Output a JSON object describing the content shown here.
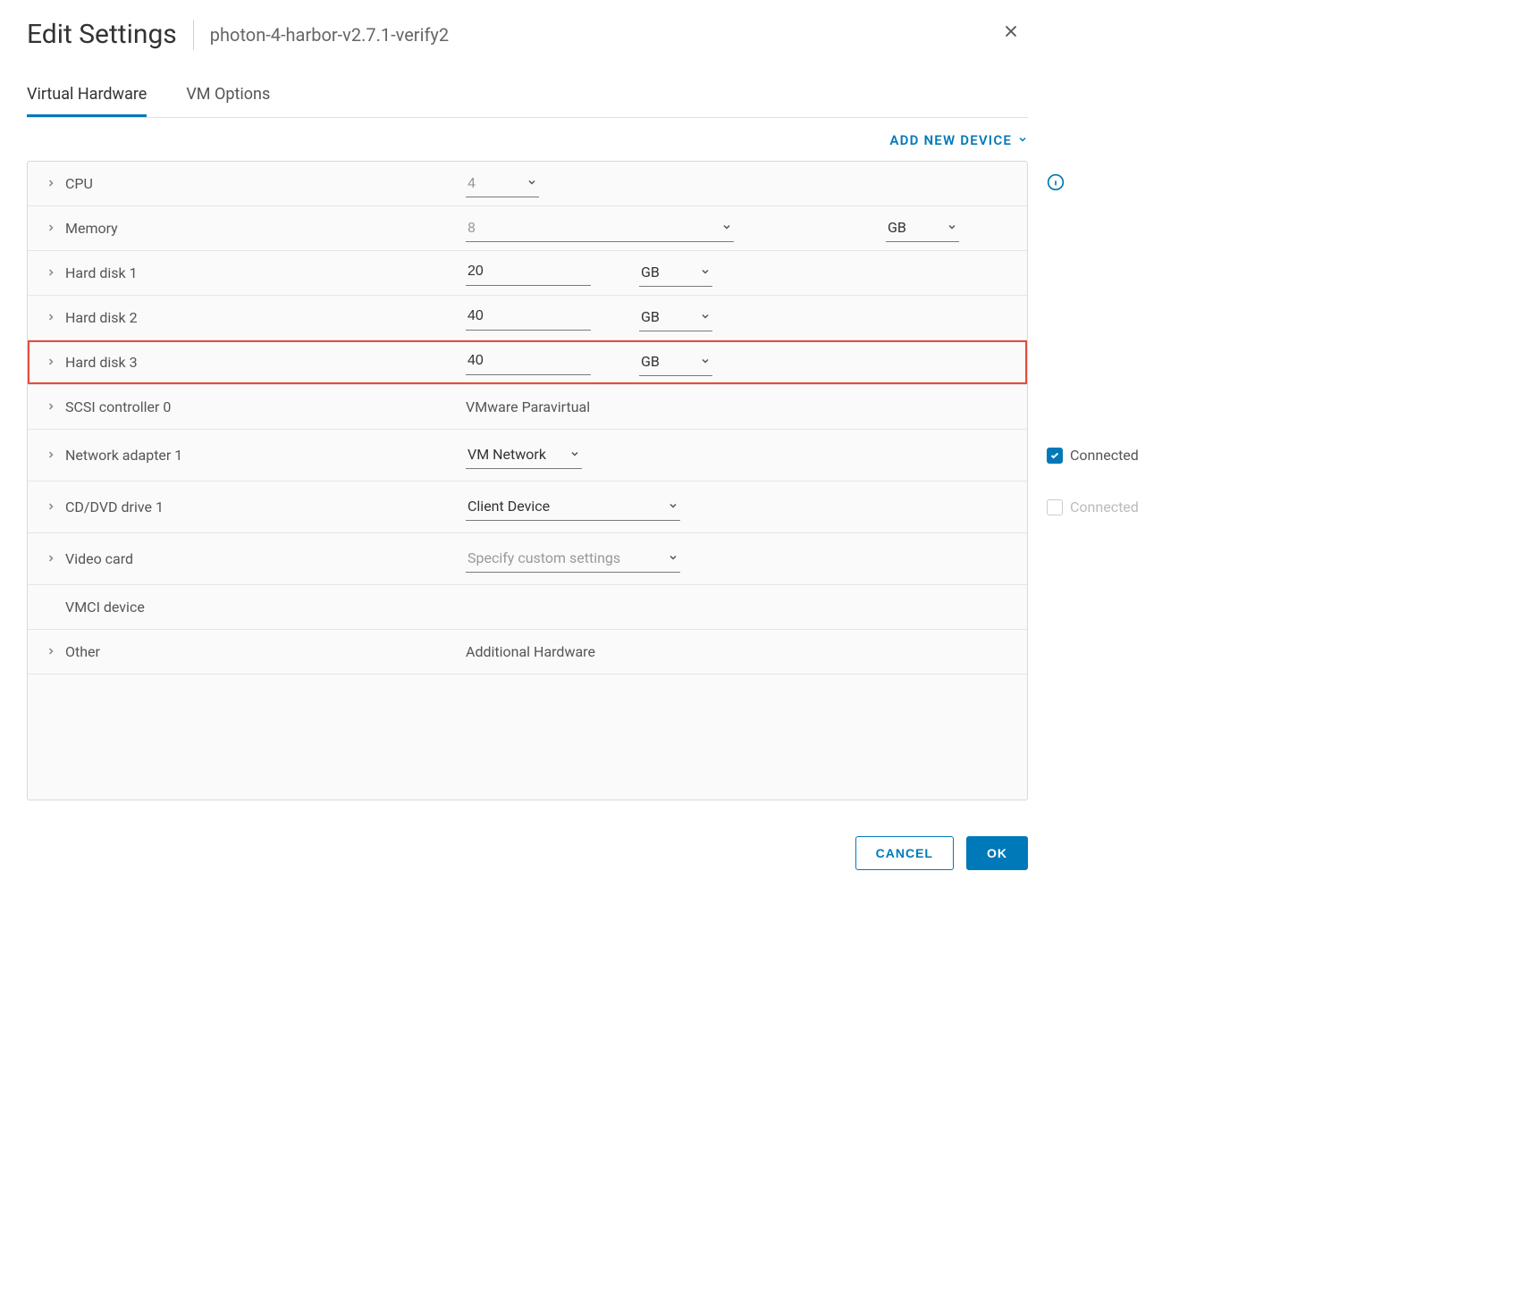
{
  "header": {
    "title": "Edit Settings",
    "subtitle": "photon-4-harbor-v2.7.1-verify2"
  },
  "tabs": {
    "hardware": "Virtual Hardware",
    "options": "VM Options"
  },
  "actions": {
    "add_device": "ADD NEW DEVICE"
  },
  "rows": {
    "cpu": {
      "label": "CPU",
      "value": "4"
    },
    "memory": {
      "label": "Memory",
      "value": "8",
      "unit": "GB"
    },
    "hd1": {
      "label": "Hard disk 1",
      "value": "20",
      "unit": "GB"
    },
    "hd2": {
      "label": "Hard disk 2",
      "value": "40",
      "unit": "GB"
    },
    "hd3": {
      "label": "Hard disk 3",
      "value": "40",
      "unit": "GB"
    },
    "scsi": {
      "label": "SCSI controller 0",
      "value": "VMware Paravirtual"
    },
    "net": {
      "label": "Network adapter 1",
      "value": "VM Network",
      "connected_label": "Connected"
    },
    "cd": {
      "label": "CD/DVD drive 1",
      "value": "Client Device",
      "connected_label": "Connected"
    },
    "video": {
      "label": "Video card",
      "value": "Specify custom settings"
    },
    "vmci": {
      "label": "VMCI device"
    },
    "other": {
      "label": "Other",
      "value": "Additional Hardware"
    }
  },
  "footer": {
    "cancel": "CANCEL",
    "ok": "OK"
  }
}
